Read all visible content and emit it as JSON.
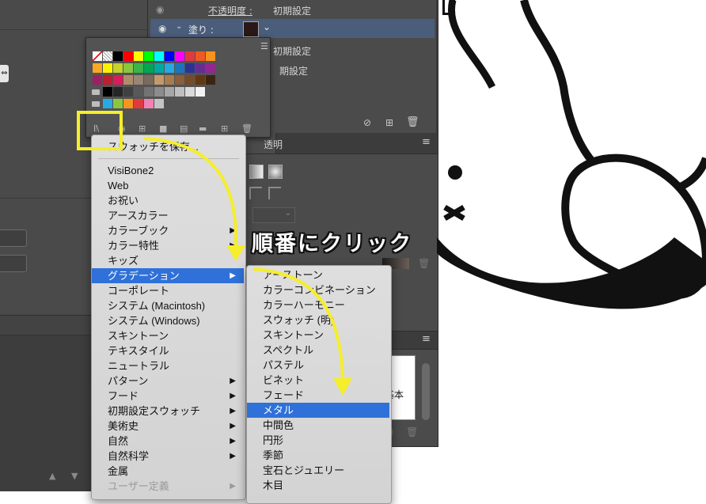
{
  "appearance_panel": {
    "opacity_label": "不透明度 :",
    "opacity_value": "初期設定",
    "fill_label": "塗り :",
    "row3_value": "初期設定",
    "row4_value": "期設定"
  },
  "transparency_tab": "透明",
  "lower_panel": {
    "text": "基本"
  },
  "swatch_colors": [
    [
      "#ffffff",
      "#ffffff",
      "#000000",
      "#ff0000",
      "#ffff00",
      "#00ff00",
      "#00ffff",
      "#0000ff",
      "#ff00ff",
      "#e03a3e",
      "#ee5a24",
      "#f7941d"
    ],
    [
      "#f9a825",
      "#fff200",
      "#c6d22e",
      "#8cc63f",
      "#39b54a",
      "#00a651",
      "#00a99d",
      "#27aae1",
      "#1c75bc",
      "#2e3192",
      "#662d91",
      "#92278f"
    ],
    [
      "#9e1f63",
      "#be1e2d",
      "#d91c5c",
      "#b08d6a",
      "#998675",
      "#7a6b5f",
      "#c49a6c",
      "#a97c50",
      "#8b5e3c",
      "#754c29",
      "#603913",
      "#3c2415"
    ],
    [
      "#000000",
      "#262626",
      "#404040",
      "#595959",
      "#737373",
      "#8c8c8c",
      "#a6a6a6",
      "#bfbfbf",
      "#d9d9d9",
      "#f2f2f2"
    ],
    [
      "#27aae1",
      "#8cc63f",
      "#f7941d",
      "#e03a3e",
      "#f282b4",
      "#c4c4c4"
    ]
  ],
  "menu_main": {
    "save_item": "スウォッチを保存...",
    "items": [
      {
        "label": "VisiBone2",
        "sub": false
      },
      {
        "label": "Web",
        "sub": false
      },
      {
        "label": "お祝い",
        "sub": false
      },
      {
        "label": "アースカラー",
        "sub": false
      },
      {
        "label": "カラーブック",
        "sub": true
      },
      {
        "label": "カラー特性",
        "sub": true
      },
      {
        "label": "キッズ",
        "sub": false
      },
      {
        "label": "グラデーション",
        "sub": true,
        "highlighted": true
      },
      {
        "label": "コーポレート",
        "sub": false
      },
      {
        "label": "システム (Macintosh)",
        "sub": false
      },
      {
        "label": "システム (Windows)",
        "sub": false
      },
      {
        "label": "スキントーン",
        "sub": false
      },
      {
        "label": "テキスタイル",
        "sub": false
      },
      {
        "label": "ニュートラル",
        "sub": false
      },
      {
        "label": "パターン",
        "sub": true
      },
      {
        "label": "フード",
        "sub": true
      },
      {
        "label": "初期設定スウォッチ",
        "sub": true
      },
      {
        "label": "美術史",
        "sub": true
      },
      {
        "label": "自然",
        "sub": true
      },
      {
        "label": "自然科学",
        "sub": true
      },
      {
        "label": "金属",
        "sub": false
      },
      {
        "label": "ユーザー定義",
        "sub": true,
        "disabled": true
      }
    ]
  },
  "menu_sub": {
    "items": [
      {
        "label": "アーストーン"
      },
      {
        "label": "カラーコンビネーション"
      },
      {
        "label": "カラーハーモニー"
      },
      {
        "label": "スウォッチ (明)"
      },
      {
        "label": "スキントーン"
      },
      {
        "label": "スペクトル"
      },
      {
        "label": "パステル"
      },
      {
        "label": "ビネット"
      },
      {
        "label": "フェード"
      },
      {
        "label": "メタル",
        "highlighted": true
      },
      {
        "label": "中間色"
      },
      {
        "label": "円形"
      },
      {
        "label": "季節"
      },
      {
        "label": "宝石とジュエリー"
      },
      {
        "label": "木目"
      }
    ]
  },
  "annotation": {
    "text": "順番にクリック",
    "highlight_color": "#f5ee2a"
  },
  "colors": {
    "menu_highlight": "#2f71d9",
    "panel_bg": "#4b4b4b",
    "arrow": "#f5ee2a"
  }
}
